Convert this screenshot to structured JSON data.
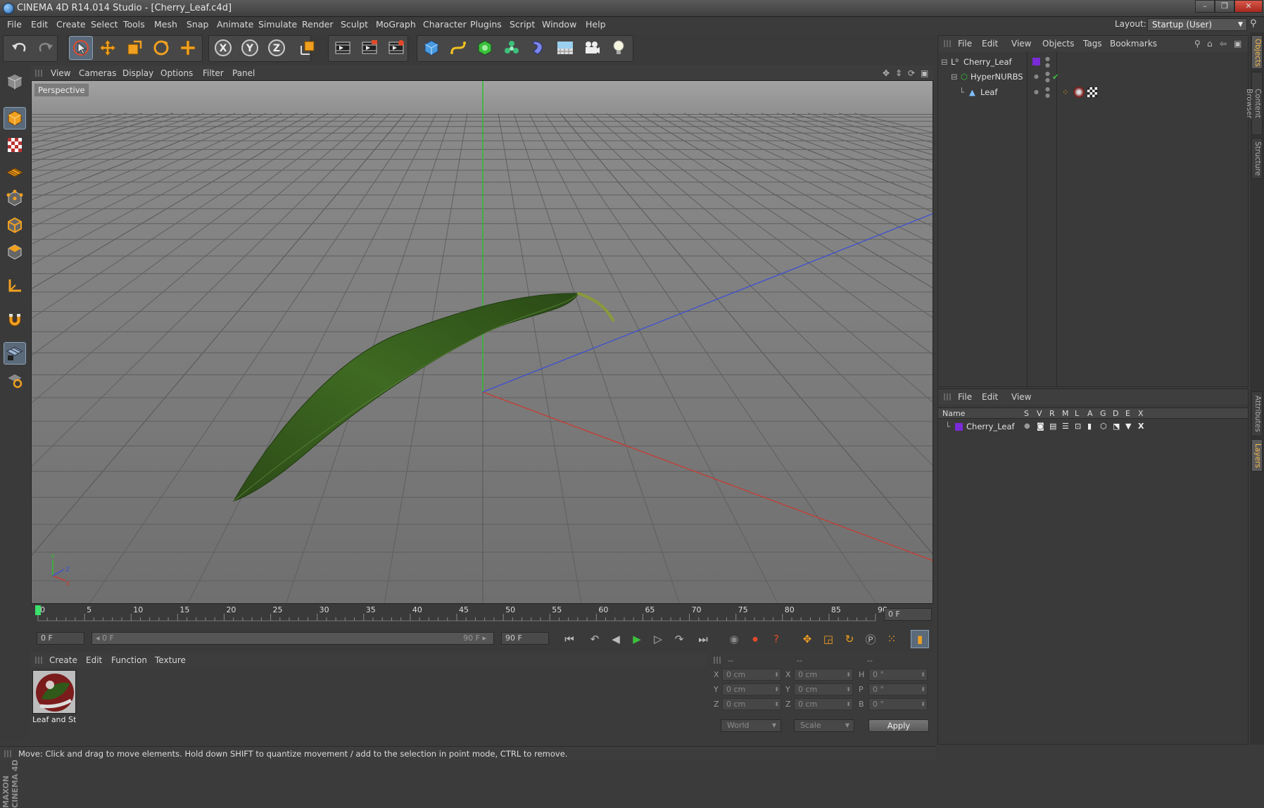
{
  "window": {
    "title": "CINEMA 4D R14.014 Studio - [Cherry_Leaf.c4d]",
    "minimize": "–",
    "maximize": "❐",
    "close": "✕"
  },
  "menu": [
    "File",
    "Edit",
    "Create",
    "Select",
    "Tools",
    "Mesh",
    "Snap",
    "Animate",
    "Simulate",
    "Render",
    "Sculpt",
    "MoGraph",
    "Character",
    "Plugins",
    "Script",
    "Window",
    "Help"
  ],
  "layout": {
    "label": "Layout:",
    "value": "Startup (User)"
  },
  "toolbar": {
    "icons": [
      "undo-icon",
      "redo-icon",
      "live-selection-icon",
      "move-icon",
      "scale-icon",
      "rotate-icon",
      "add-tool-icon",
      "x-axis-icon",
      "y-axis-icon",
      "z-axis-icon",
      "coordinate-system-icon",
      "render-view-icon",
      "render-picture-viewer-icon",
      "edit-render-settings-icon",
      "cube-primitive-icon",
      "spline-icon",
      "nurbs-icon",
      "mograph-cloner-icon",
      "deformer-icon",
      "floor-scene-icon",
      "camera-icon",
      "light-icon"
    ],
    "axis_labels": {
      "x": "X",
      "y": "Y",
      "z": "Z"
    }
  },
  "viewport": {
    "menu": [
      "View",
      "Cameras",
      "Display",
      "Options",
      "Filter",
      "Panel"
    ],
    "label": "Perspective",
    "axis_gizmo": {
      "x": "X",
      "y": "Y",
      "z": "Z"
    }
  },
  "timeline": {
    "ticks": [
      "0",
      "5",
      "10",
      "15",
      "20",
      "25",
      "30",
      "35",
      "40",
      "45",
      "50",
      "55",
      "60",
      "65",
      "70",
      "75",
      "80",
      "85",
      "90"
    ],
    "current_frame_display": "0 F",
    "current_frame": 0,
    "max_frame": 90
  },
  "transport": {
    "start_field": "0 F",
    "range_start": "◂ 0 F",
    "range_end": "90 F ▸",
    "end_field": "90 F"
  },
  "material_manager": {
    "menu": [
      "Create",
      "Edit",
      "Function",
      "Texture"
    ],
    "material_name": "Leaf and St"
  },
  "coordinates": {
    "headers": [
      "--",
      "--",
      "--"
    ],
    "rows": [
      {
        "l1": "X",
        "v1": "0 cm",
        "l2": "X",
        "v2": "0 cm",
        "l3": "H",
        "v3": "0 °"
      },
      {
        "l1": "Y",
        "v1": "0 cm",
        "l2": "Y",
        "v2": "0 cm",
        "l3": "P",
        "v3": "0 °"
      },
      {
        "l1": "Z",
        "v1": "0 cm",
        "l2": "Z",
        "v2": "0 cm",
        "l3": "B",
        "v3": "0 °"
      }
    ],
    "space": "World",
    "mode": "Scale",
    "apply": "Apply"
  },
  "status": "Move: Click and drag to move elements. Hold down SHIFT to quantize movement / add to the selection in point mode, CTRL to remove.",
  "brand": "MAXON CINEMA 4D",
  "object_manager": {
    "menu": [
      "File",
      "Edit",
      "View",
      "Objects",
      "Tags",
      "Bookmarks"
    ],
    "objects": [
      {
        "name": "Cherry_Leaf",
        "type": "null",
        "indent": 0
      },
      {
        "name": "HyperNURBS",
        "type": "hypernurbs",
        "indent": 1
      },
      {
        "name": "Leaf",
        "type": "polygon",
        "indent": 2
      }
    ]
  },
  "layer_manager": {
    "menu": [
      "File",
      "Edit",
      "View"
    ],
    "columns": [
      "Name",
      "S",
      "V",
      "R",
      "M",
      "L",
      "A",
      "G",
      "D",
      "E",
      "X"
    ],
    "layers": [
      {
        "name": "Cherry_Leaf",
        "color": "#7a2ad6"
      }
    ]
  },
  "right_tabs": [
    "Objects",
    "Content Browser",
    "Structure",
    "Attributes",
    "Layers"
  ],
  "colors": {
    "accent": "#f3b84d",
    "layer_purple": "#7a2ad6",
    "axis_x": "#c83c32",
    "axis_y": "#2fbf2f",
    "axis_z": "#3c4fd2"
  }
}
